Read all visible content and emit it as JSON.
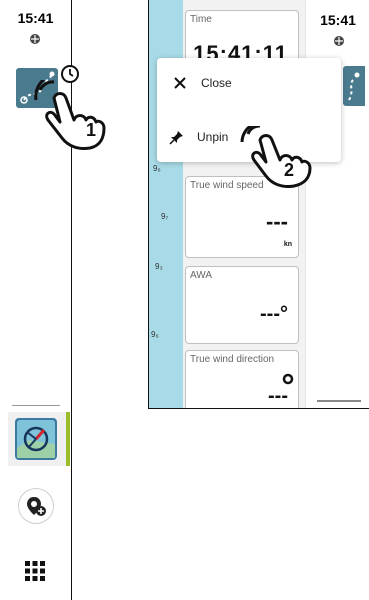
{
  "left_panel": {
    "time": "15:41",
    "gps_icon": "satellite-icon",
    "route_icon": "route-icon",
    "clock_icon": "clock-icon",
    "app_icon": "chartplotter-icon",
    "waypoint_icon": "waypoint-add-icon",
    "apps_icon": "apps-grid-icon",
    "step_label": "1"
  },
  "right_panel": {
    "time": "15:41",
    "tiles": [
      {
        "label": "Time",
        "value": "15:41:11",
        "unit": ""
      },
      {
        "label": "True wind speed",
        "value": "---",
        "unit": "kn"
      },
      {
        "label": "AWA",
        "value": "---°",
        "unit": ""
      },
      {
        "label": "True wind direction",
        "value": "---",
        "unit": ""
      }
    ],
    "depths": [
      "9₆",
      "9₇",
      "9₃",
      "9₆"
    ],
    "menu": {
      "close_label": "Close",
      "unpin_label": "Unpin"
    },
    "step_label": "2"
  },
  "colors": {
    "water": "#a8dbe7",
    "route_button": "#4a7a8e",
    "active_indicator": "#9bbd2b"
  }
}
